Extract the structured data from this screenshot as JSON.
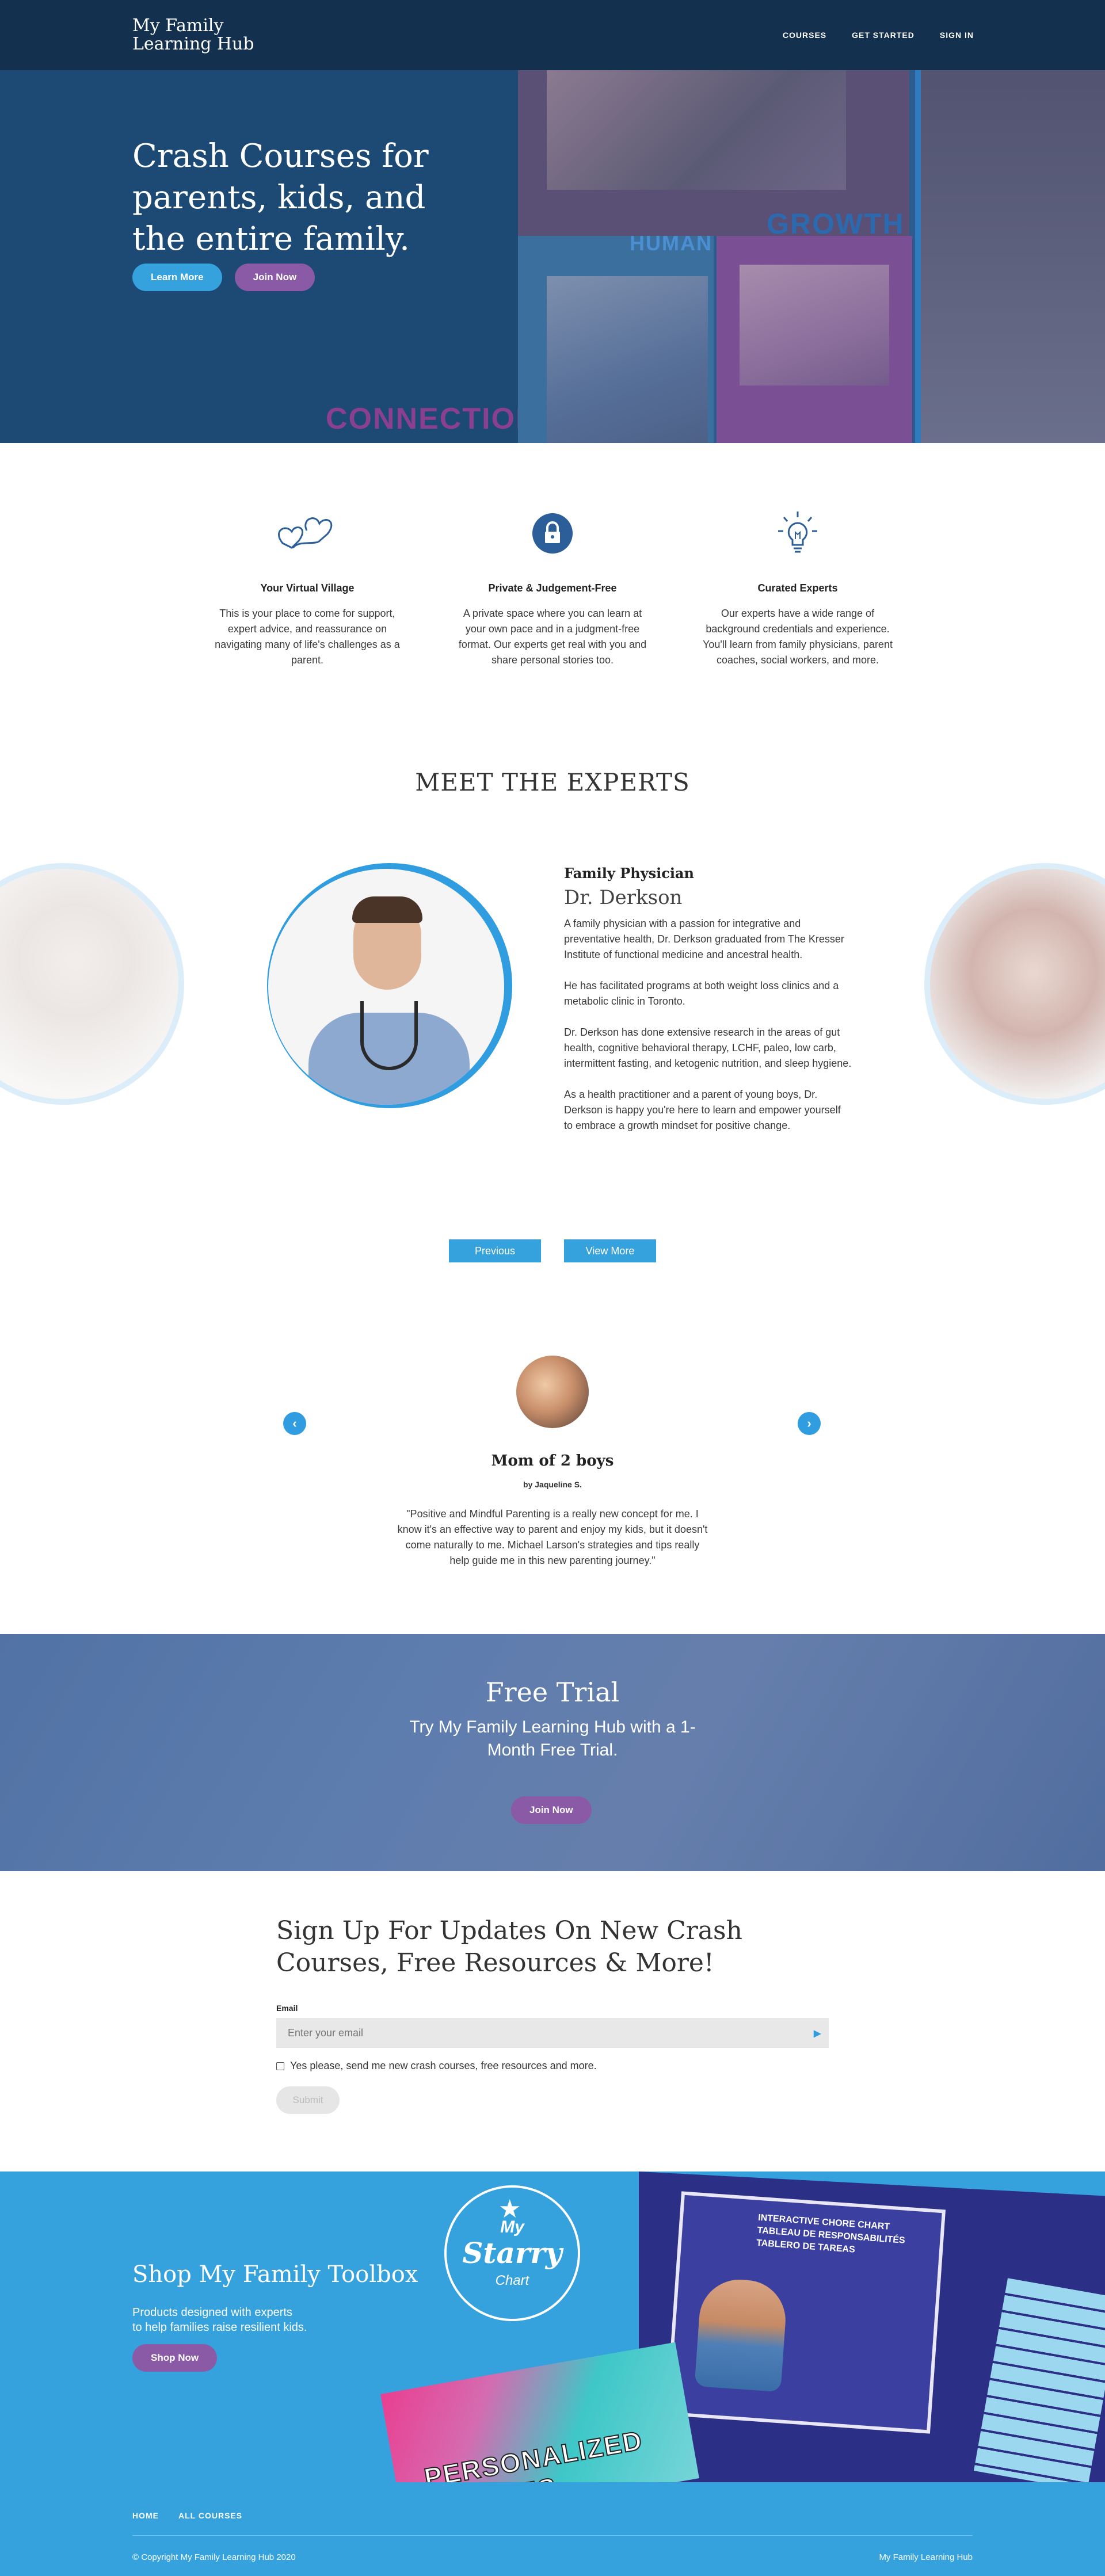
{
  "header": {
    "brand": "My Family\nLearning Hub",
    "nav": [
      "COURSES",
      "GET STARTED",
      "SIGN IN"
    ]
  },
  "hero": {
    "title": "Crash Courses for parents, kids, and the entire family.",
    "learn_more": "Learn More",
    "join_now": "Join Now",
    "collage_words": {
      "connection": "CONNECTION",
      "human": "HUMAN",
      "growth": "GROWTH"
    }
  },
  "features": [
    {
      "icon": "hearts-icon",
      "title": "Your Virtual Village",
      "text": "This is your place to come for support, expert advice, and reassurance on navigating many of life's challenges as a parent."
    },
    {
      "icon": "lock-icon",
      "title": "Private & Judgement-Free",
      "text": "A private space where you can learn at your own pace and in a judgment-free format. Our experts get real with you and share personal stories too."
    },
    {
      "icon": "lightbulb-icon",
      "title": "Curated Experts",
      "text": "Our experts have a wide range of background credentials and experience. You'll learn from family physicians, parent coaches, social workers, and more."
    }
  ],
  "experts": {
    "heading": "MEET THE EXPERTS",
    "role": "Family Physician",
    "name": "Dr. Derkson",
    "bio": [
      "A family physician with a passion for integrative and preventative health, Dr. Derkson graduated from The Kresser Institute of functional medicine and ancestral health.",
      "He has facilitated programs at both weight loss clinics and a metabolic clinic in Toronto.",
      "Dr. Derkson has done extensive research in the areas of gut health, cognitive behavioral therapy, LCHF, paleo, low carb, intermittent fasting, and ketogenic nutrition, and sleep hygiene.",
      "As a health practitioner and a parent of young boys, Dr. Derkson is happy you're here to learn and empower yourself to embrace a growth mindset for positive change."
    ],
    "previous": "Previous",
    "view_more": "View More"
  },
  "testimonial": {
    "title": "Mom of 2 boys",
    "author": "by Jaqueline S.",
    "quote": "\"Positive and Mindful Parenting is a really new concept for me. I know it's an effective way to parent and enjoy my kids, but it doesn't come naturally to me. Michael Larson's strategies and tips really help guide me in this new parenting journey.\""
  },
  "trial": {
    "title": "Free Trial",
    "subtitle": "Try My Family Learning Hub with a 1-Month Free Trial.",
    "button": "Join Now"
  },
  "signup": {
    "heading": "Sign Up For Updates On New Crash Courses, Free Resources & More!",
    "email_label": "Email",
    "email_placeholder": "Enter your email",
    "consent": "Yes please, send me new crash courses, free resources and more.",
    "submit": "Submit"
  },
  "shop": {
    "title": "Shop My Family Toolbox",
    "subtitle": "Products designed with experts\nto help families raise resilient kids.",
    "button": "Shop Now",
    "logo_my": "My",
    "logo_starry": "Starry",
    "logo_chart": "Chart",
    "product_text": "INTERACTIVE CHORE CHART\nTABLEAU DE RESPONSABILITÉS\nTABLERO DE TAREAS",
    "puzzle_text": "PERSONALIZED PUZZLES"
  },
  "footer": {
    "nav": [
      "HOME",
      "ALL COURSES"
    ],
    "copyright": "© Copyright My Family Learning Hub 2020",
    "brand": "My Family Learning Hub"
  },
  "colors": {
    "navy": "#14304f",
    "hero_blue": "#1d4a74",
    "accent_blue": "#35a2de",
    "purple": "#8a5aa6"
  }
}
